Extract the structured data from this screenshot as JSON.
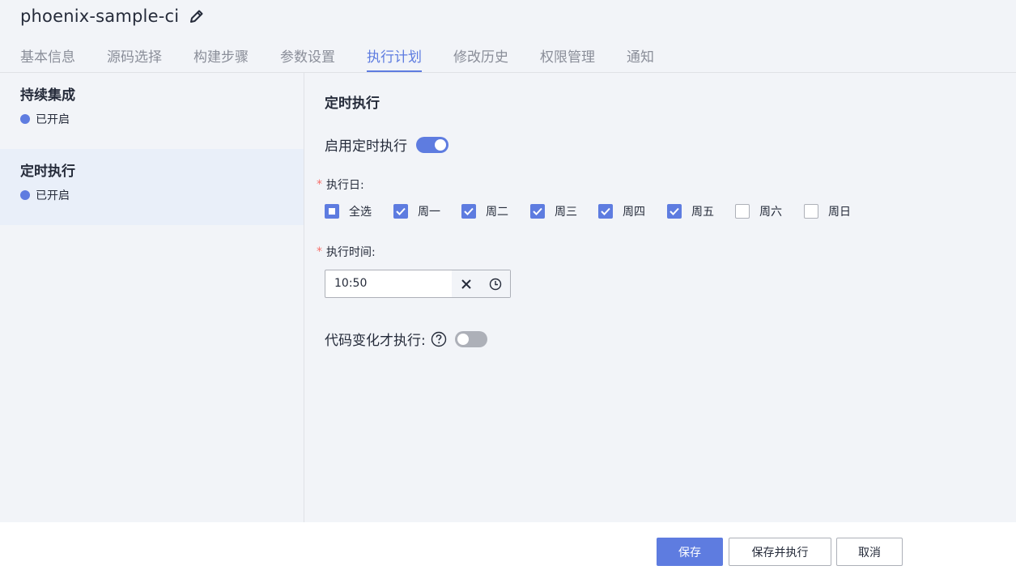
{
  "header": {
    "title": "phoenix-sample-ci",
    "tabs": [
      "基本信息",
      "源码选择",
      "构建步骤",
      "参数设置",
      "执行计划",
      "修改历史",
      "权限管理",
      "通知"
    ],
    "active_tab": "执行计划"
  },
  "sidebar": {
    "items": [
      {
        "title": "持续集成",
        "status": "已开启"
      },
      {
        "title": "定时执行",
        "status": "已开启"
      }
    ]
  },
  "main": {
    "section_title": "定时执行",
    "enable_label": "启用定时执行",
    "enable_on": true,
    "days_label": "执行日:",
    "days": [
      {
        "label": "全选",
        "state": "indeterminate"
      },
      {
        "label": "周一",
        "state": "checked"
      },
      {
        "label": "周二",
        "state": "checked"
      },
      {
        "label": "周三",
        "state": "checked"
      },
      {
        "label": "周四",
        "state": "checked"
      },
      {
        "label": "周五",
        "state": "checked"
      },
      {
        "label": "周六",
        "state": "unchecked"
      },
      {
        "label": "周日",
        "state": "unchecked"
      }
    ],
    "time_label": "执行时间:",
    "time_value": "10:50",
    "code_change_label": "代码变化才执行:",
    "code_change_on": false
  },
  "footer": {
    "save": "保存",
    "save_run": "保存并执行",
    "cancel": "取消"
  },
  "colors": {
    "accent": "#5e7ce0",
    "required": "#f66f6a",
    "toggle_off": "#adb0b8"
  }
}
